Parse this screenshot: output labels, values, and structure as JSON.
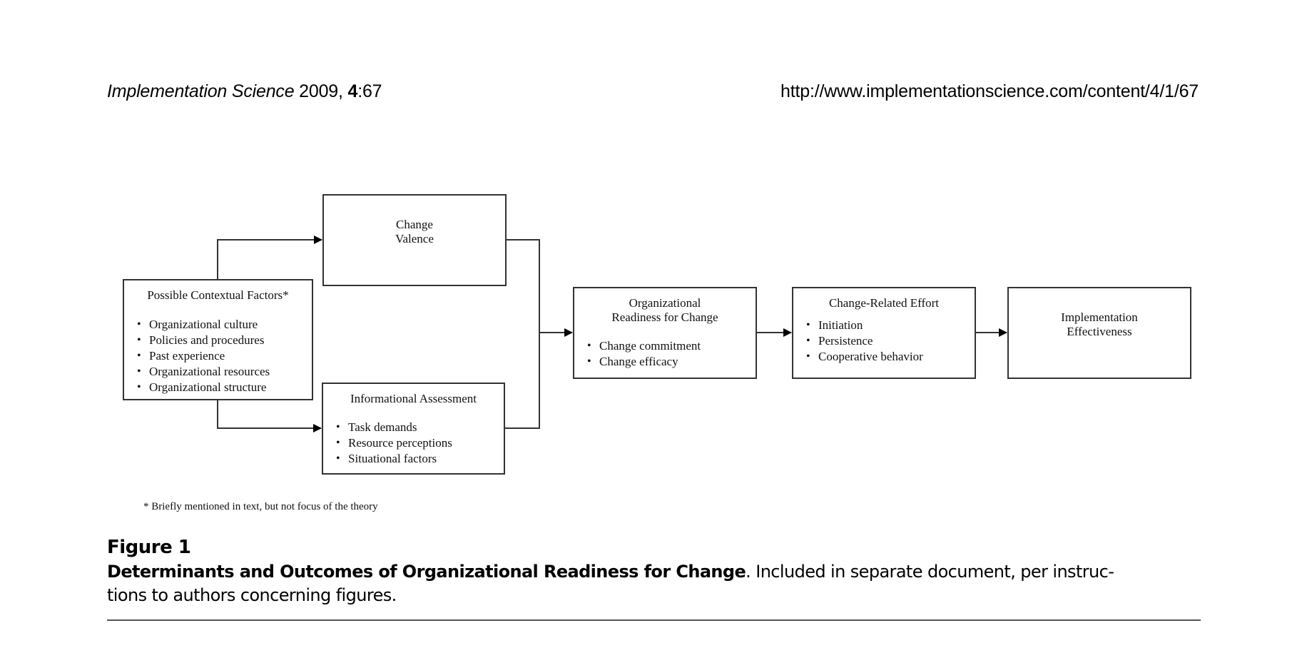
{
  "header": {
    "journal": "Implementation Science",
    "year": "2009,",
    "volume": "4",
    "article": ":67",
    "url": "http://www.implementationscience.com/content/4/1/67"
  },
  "diagram": {
    "valence": {
      "title_line1": "Change",
      "title_line2": "Valence"
    },
    "context": {
      "title": "Possible Contextual Factors*",
      "items": [
        "Organizational culture",
        "Policies and procedures",
        "Past experience",
        "Organizational resources",
        "Organizational structure"
      ]
    },
    "info": {
      "title": "Informational Assessment",
      "items": [
        "Task demands",
        "Resource perceptions",
        "Situational factors"
      ]
    },
    "readiness": {
      "title_line1": "Organizational",
      "title_line2": "Readiness for Change",
      "items": [
        "Change commitment",
        "Change efficacy"
      ]
    },
    "effort": {
      "title": "Change-Related Effort",
      "items": [
        "Initiation",
        "Persistence",
        "Cooperative behavior"
      ]
    },
    "implementation": {
      "title_line1": "Implementation",
      "title_line2": "Effectiveness"
    },
    "footnote": "* Briefly mentioned in text, but not focus of the theory"
  },
  "figure": {
    "label": "Figure 1",
    "caption_bold": "Determinants and Outcomes of Organizational Readiness for Change",
    "caption_rest": ". Included in separate document, per instruc-",
    "caption_line2": "tions to authors concerning figures."
  }
}
